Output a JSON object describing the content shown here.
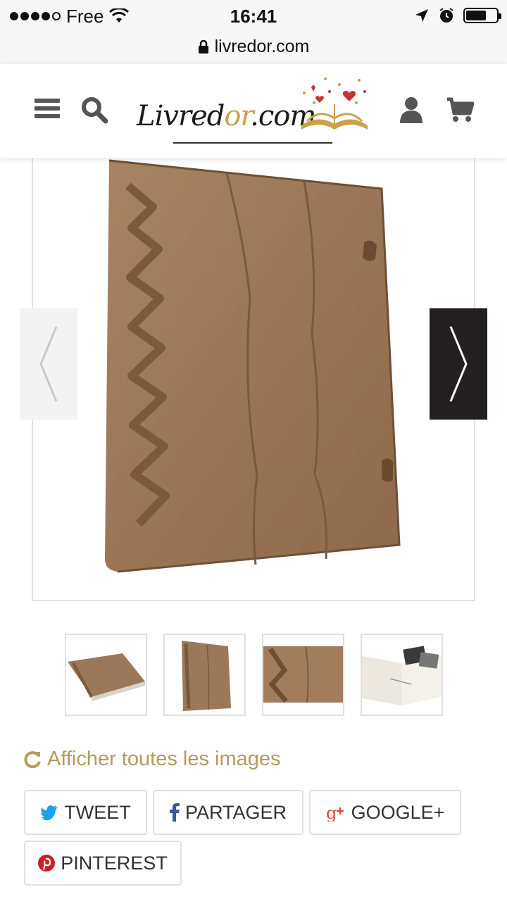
{
  "status_bar": {
    "carrier": "Free",
    "time": "16:41"
  },
  "browser": {
    "url": "livredor.com"
  },
  "header": {
    "logo_main": "Livred",
    "logo_accent": "or",
    "logo_suffix": ".com",
    "icons": [
      "menu-icon",
      "search-icon",
      "user-icon",
      "cart-icon"
    ]
  },
  "gallery": {
    "thumbnail_count": 4,
    "show_all_label": "Afficher toutes les images"
  },
  "share_buttons": {
    "tweet": "TWEET",
    "partager": "PARTAGER",
    "google": "GOOGLE+",
    "pinterest": "PINTEREST"
  },
  "colors": {
    "accent_gold": "#b59a5e",
    "arrow_dark": "#231f20",
    "twitter_blue": "#1da1f2",
    "facebook_blue": "#3b5998",
    "google_red": "#dd4b39",
    "pinterest_red": "#cb2027"
  }
}
